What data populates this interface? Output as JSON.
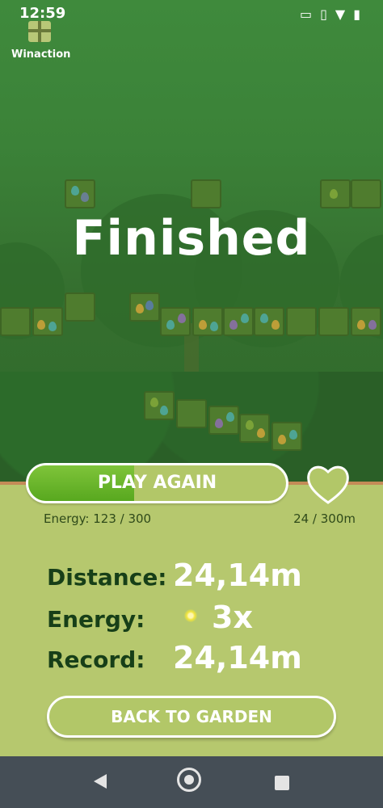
{
  "status_bar": {
    "time": "12:59"
  },
  "winaction": {
    "label": "Winaction"
  },
  "game": {
    "title": "Finished",
    "play_again_label": "PLAY AGAIN",
    "energy_text": "Energy: 123 / 300",
    "energy_fraction": 0.41,
    "distance_text": "24 / 300m",
    "stats": {
      "distance_label": "Distance:",
      "distance_value": "24,14m",
      "energy_label": "Energy:",
      "energy_value": "3x",
      "record_label": "Record:",
      "record_value": "24,14m"
    },
    "back_label": "BACK TO GARDEN"
  },
  "colors": {
    "accent_green": "#58a81f",
    "panel": "#b6c86e",
    "stat_label": "#173f18"
  }
}
